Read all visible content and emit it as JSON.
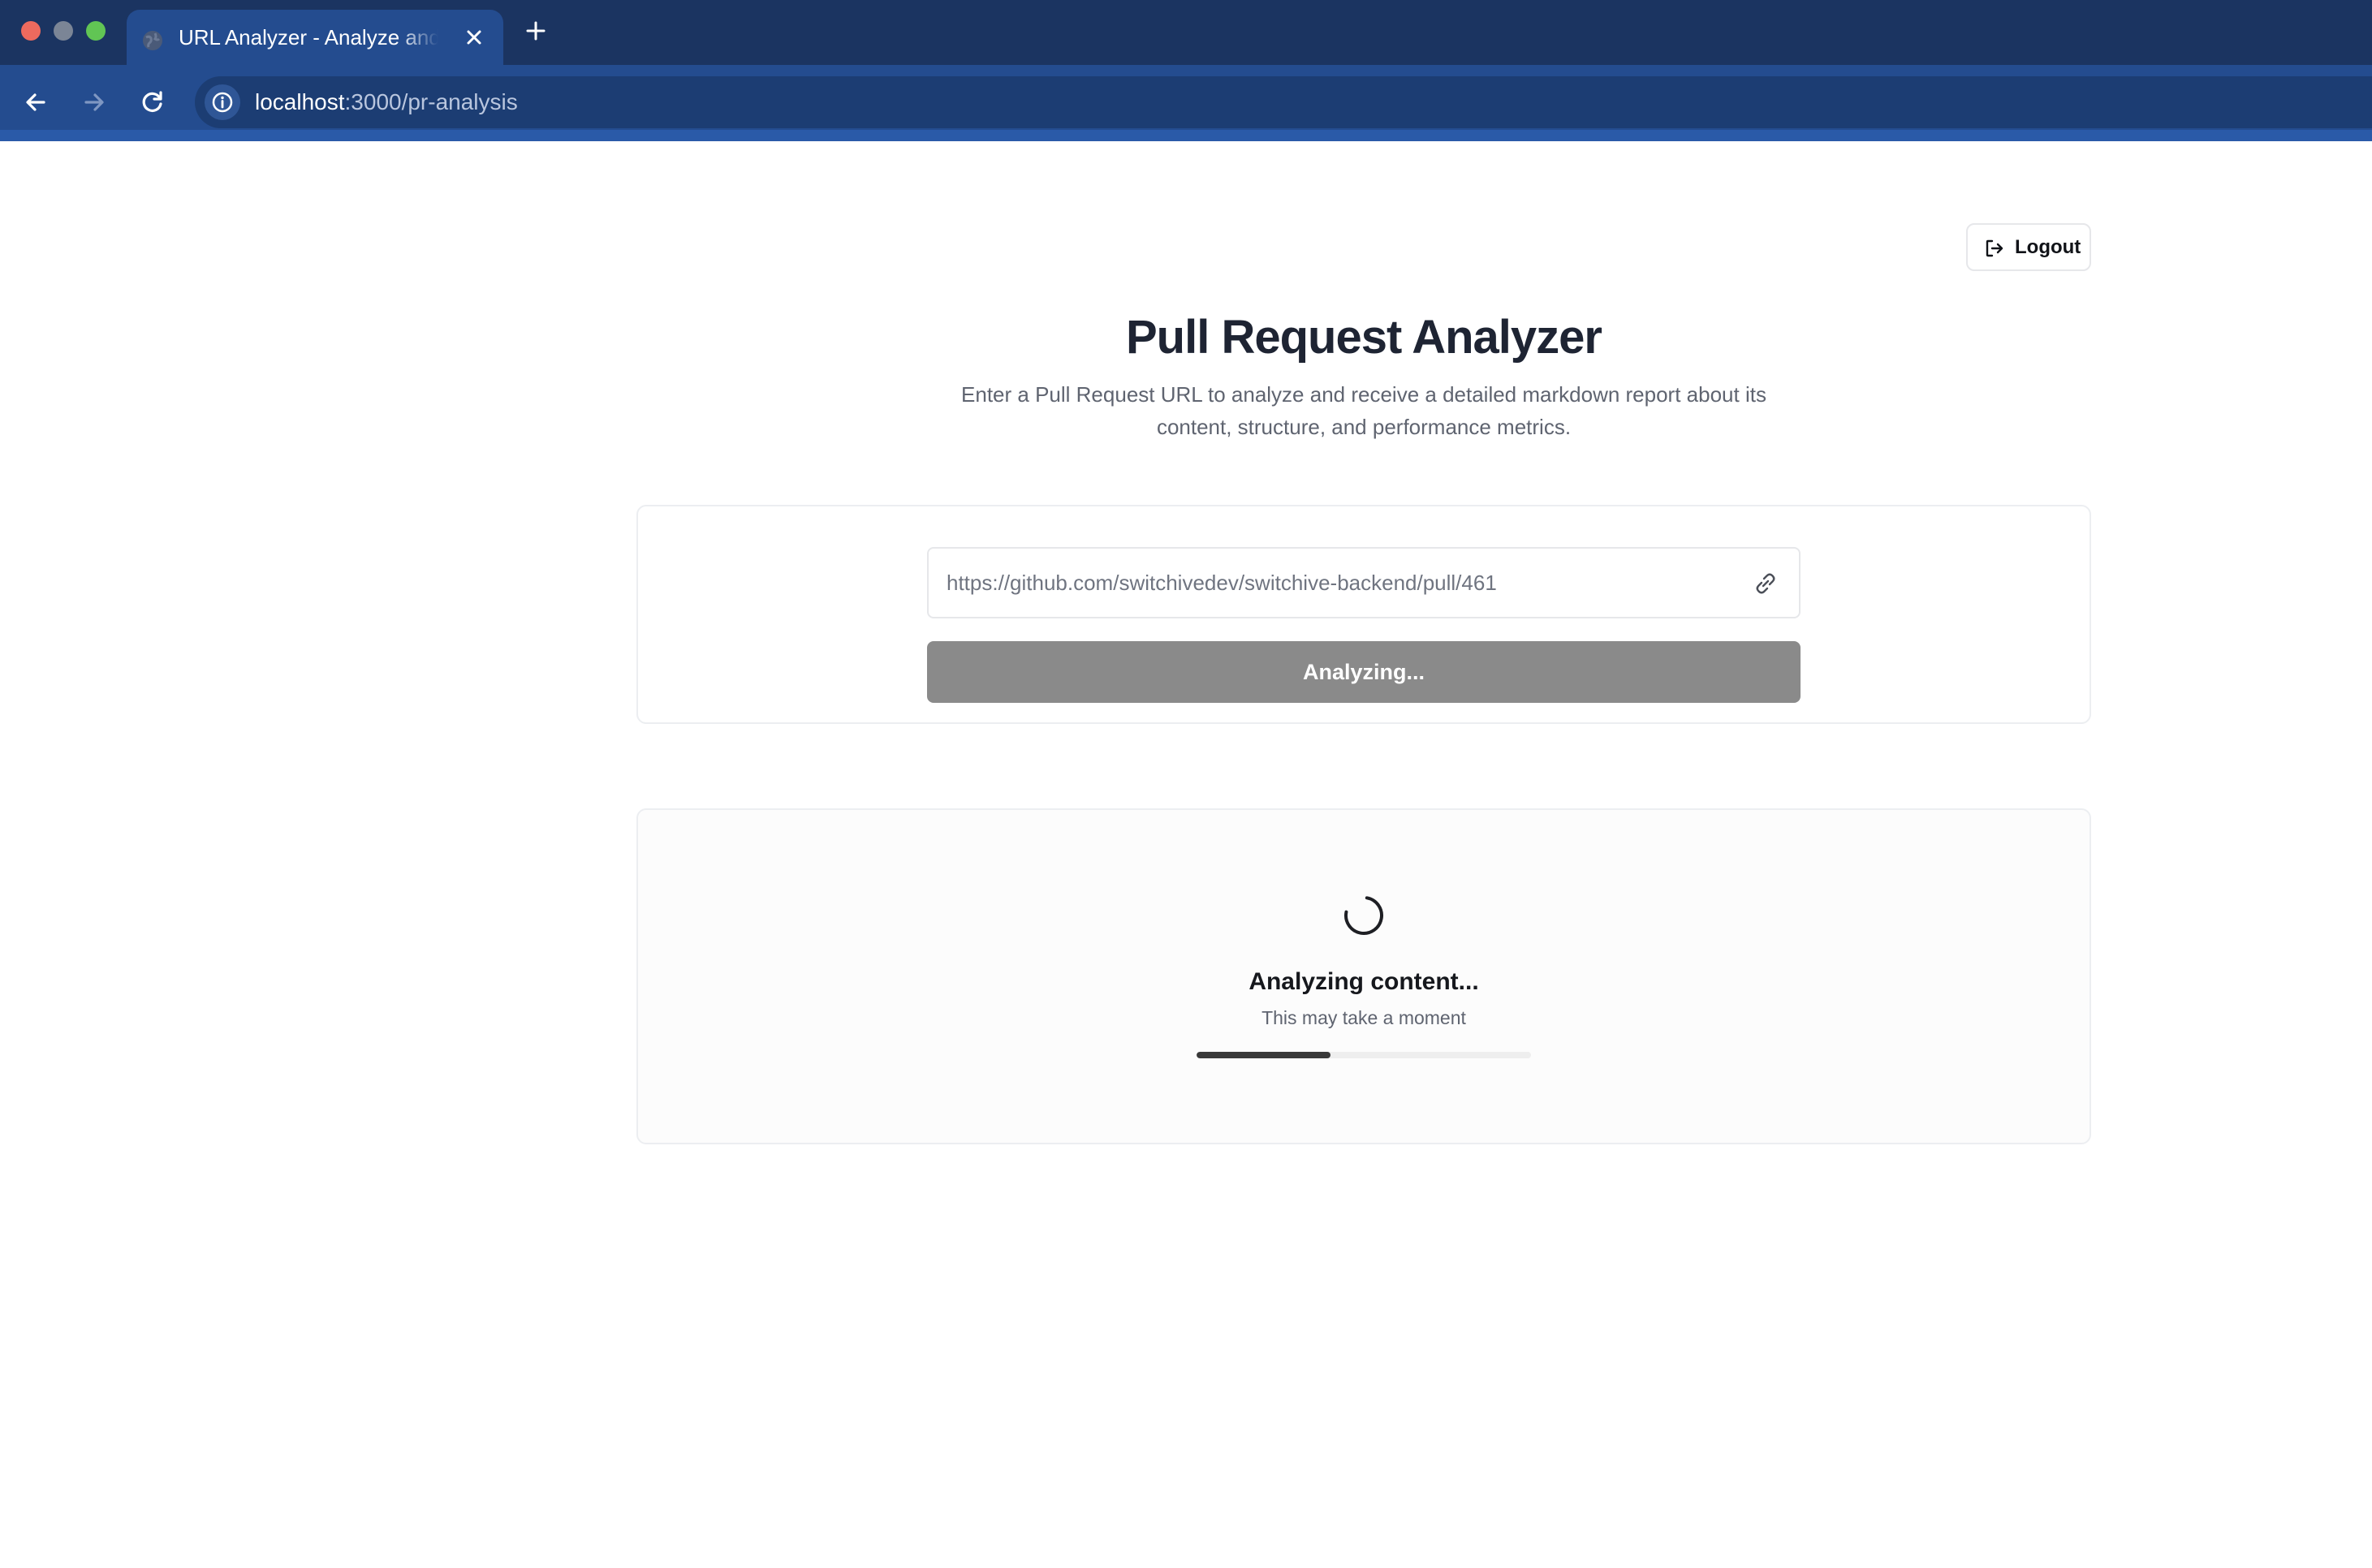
{
  "browser": {
    "tab": {
      "title": "URL Analyzer - Analyze and Visualize",
      "favicon": "globe-icon",
      "close_icon": "close-icon"
    },
    "new_tab_icon": "plus-icon",
    "nav": {
      "back_icon": "arrow-left-icon",
      "forward_icon": "arrow-right-icon",
      "reload_icon": "reload-icon",
      "site_info_icon": "info-icon"
    },
    "address": {
      "host": "localhost",
      "rest": ":3000/pr-analysis"
    },
    "colors": {
      "tabbar": "#1b3461",
      "toolbar": "#244c8f"
    }
  },
  "header": {
    "logout_label": "Logout",
    "logout_icon": "logout-icon"
  },
  "main": {
    "title": "Pull Request Analyzer",
    "subtitle": "Enter a Pull Request URL to analyze and receive a detailed markdown report about its content, structure, and performance metrics."
  },
  "form": {
    "url_value": "https://github.com/switchivedev/switchive-backend/pull/461",
    "url_icon": "link-icon",
    "submit_label": "Analyzing...",
    "submit_disabled": true
  },
  "status": {
    "spinner_icon": "spinner-icon",
    "title": "Analyzing content...",
    "subtitle": "This may take a moment",
    "progress": 0.4
  }
}
